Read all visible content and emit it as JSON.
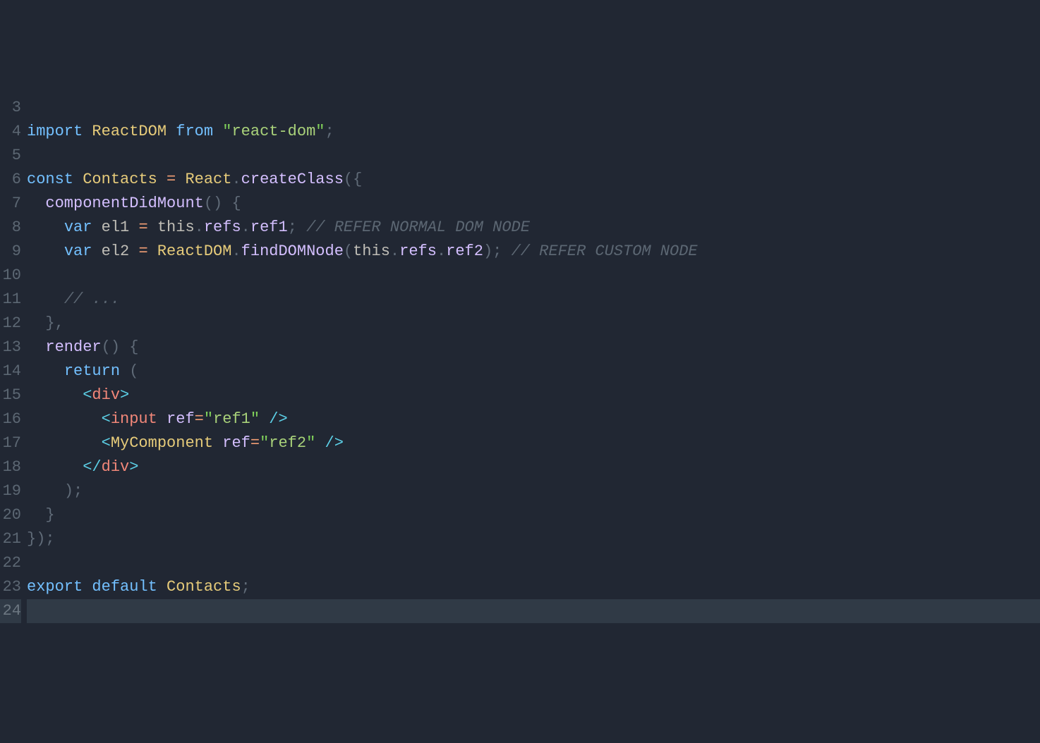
{
  "lines": [
    {
      "num": "3",
      "current": false,
      "tokens": []
    },
    {
      "num": "4",
      "current": false,
      "tokens": [
        {
          "cls": "kw",
          "t": "import"
        },
        {
          "cls": "",
          "t": " "
        },
        {
          "cls": "class",
          "t": "ReactDOM"
        },
        {
          "cls": "",
          "t": " "
        },
        {
          "cls": "kw",
          "t": "from"
        },
        {
          "cls": "",
          "t": " "
        },
        {
          "cls": "strq",
          "t": "\""
        },
        {
          "cls": "str",
          "t": "react-dom"
        },
        {
          "cls": "strq",
          "t": "\""
        },
        {
          "cls": "punct",
          "t": ";"
        }
      ]
    },
    {
      "num": "5",
      "current": false,
      "tokens": []
    },
    {
      "num": "6",
      "current": false,
      "tokens": [
        {
          "cls": "kw",
          "t": "const"
        },
        {
          "cls": "",
          "t": " "
        },
        {
          "cls": "class",
          "t": "Contacts"
        },
        {
          "cls": "",
          "t": " "
        },
        {
          "cls": "op",
          "t": "="
        },
        {
          "cls": "",
          "t": " "
        },
        {
          "cls": "class",
          "t": "React"
        },
        {
          "cls": "punct",
          "t": "."
        },
        {
          "cls": "method",
          "t": "createClass"
        },
        {
          "cls": "punct",
          "t": "({"
        }
      ]
    },
    {
      "num": "7",
      "current": false,
      "tokens": [
        {
          "cls": "",
          "t": "  "
        },
        {
          "cls": "method",
          "t": "componentDidMount"
        },
        {
          "cls": "punct",
          "t": "()"
        },
        {
          "cls": "",
          "t": " "
        },
        {
          "cls": "punct",
          "t": "{"
        }
      ]
    },
    {
      "num": "8",
      "current": false,
      "tokens": [
        {
          "cls": "",
          "t": "    "
        },
        {
          "cls": "kw",
          "t": "var"
        },
        {
          "cls": "",
          "t": " "
        },
        {
          "cls": "localv",
          "t": "el1"
        },
        {
          "cls": "",
          "t": " "
        },
        {
          "cls": "op",
          "t": "="
        },
        {
          "cls": "",
          "t": " "
        },
        {
          "cls": "localv",
          "t": "this"
        },
        {
          "cls": "punct",
          "t": "."
        },
        {
          "cls": "prop",
          "t": "refs"
        },
        {
          "cls": "punct",
          "t": "."
        },
        {
          "cls": "prop",
          "t": "ref1"
        },
        {
          "cls": "punct",
          "t": ";"
        },
        {
          "cls": "",
          "t": " "
        },
        {
          "cls": "comment",
          "t": "// REFER NORMAL DOM NODE"
        }
      ]
    },
    {
      "num": "9",
      "current": false,
      "tokens": [
        {
          "cls": "",
          "t": "    "
        },
        {
          "cls": "kw",
          "t": "var"
        },
        {
          "cls": "",
          "t": " "
        },
        {
          "cls": "localv",
          "t": "el2"
        },
        {
          "cls": "",
          "t": " "
        },
        {
          "cls": "op",
          "t": "="
        },
        {
          "cls": "",
          "t": " "
        },
        {
          "cls": "class",
          "t": "ReactDOM"
        },
        {
          "cls": "punct",
          "t": "."
        },
        {
          "cls": "method",
          "t": "findDOMNode"
        },
        {
          "cls": "punct",
          "t": "("
        },
        {
          "cls": "localv",
          "t": "this"
        },
        {
          "cls": "punct",
          "t": "."
        },
        {
          "cls": "prop",
          "t": "refs"
        },
        {
          "cls": "punct",
          "t": "."
        },
        {
          "cls": "prop",
          "t": "ref2"
        },
        {
          "cls": "punct",
          "t": ");"
        },
        {
          "cls": "",
          "t": " "
        },
        {
          "cls": "comment",
          "t": "// REFER CUSTOM NODE"
        }
      ]
    },
    {
      "num": "10",
      "current": false,
      "tokens": []
    },
    {
      "num": "11",
      "current": false,
      "tokens": [
        {
          "cls": "",
          "t": "    "
        },
        {
          "cls": "comment",
          "t": "// ..."
        }
      ]
    },
    {
      "num": "12",
      "current": false,
      "tokens": [
        {
          "cls": "",
          "t": "  "
        },
        {
          "cls": "punct",
          "t": "},"
        }
      ]
    },
    {
      "num": "13",
      "current": false,
      "tokens": [
        {
          "cls": "",
          "t": "  "
        },
        {
          "cls": "method",
          "t": "render"
        },
        {
          "cls": "punct",
          "t": "()"
        },
        {
          "cls": "",
          "t": " "
        },
        {
          "cls": "punct",
          "t": "{"
        }
      ]
    },
    {
      "num": "14",
      "current": false,
      "tokens": [
        {
          "cls": "",
          "t": "    "
        },
        {
          "cls": "kw",
          "t": "return"
        },
        {
          "cls": "",
          "t": " "
        },
        {
          "cls": "punct",
          "t": "("
        }
      ]
    },
    {
      "num": "15",
      "current": false,
      "tokens": [
        {
          "cls": "",
          "t": "      "
        },
        {
          "cls": "tagb",
          "t": "<"
        },
        {
          "cls": "tag",
          "t": "div"
        },
        {
          "cls": "tagb",
          "t": ">"
        }
      ]
    },
    {
      "num": "16",
      "current": false,
      "tokens": [
        {
          "cls": "",
          "t": "        "
        },
        {
          "cls": "tagb",
          "t": "<"
        },
        {
          "cls": "tag",
          "t": "input"
        },
        {
          "cls": "",
          "t": " "
        },
        {
          "cls": "attr",
          "t": "ref"
        },
        {
          "cls": "op",
          "t": "="
        },
        {
          "cls": "strq",
          "t": "\""
        },
        {
          "cls": "str",
          "t": "ref1"
        },
        {
          "cls": "strq",
          "t": "\""
        },
        {
          "cls": "",
          "t": " "
        },
        {
          "cls": "tagb",
          "t": "/>"
        }
      ]
    },
    {
      "num": "17",
      "current": false,
      "tokens": [
        {
          "cls": "",
          "t": "        "
        },
        {
          "cls": "tagb",
          "t": "<"
        },
        {
          "cls": "class",
          "t": "MyComponent"
        },
        {
          "cls": "",
          "t": " "
        },
        {
          "cls": "attr",
          "t": "ref"
        },
        {
          "cls": "op",
          "t": "="
        },
        {
          "cls": "strq",
          "t": "\""
        },
        {
          "cls": "str",
          "t": "ref2"
        },
        {
          "cls": "strq",
          "t": "\""
        },
        {
          "cls": "",
          "t": " "
        },
        {
          "cls": "tagb",
          "t": "/>"
        }
      ]
    },
    {
      "num": "18",
      "current": false,
      "tokens": [
        {
          "cls": "",
          "t": "      "
        },
        {
          "cls": "tagb",
          "t": "</"
        },
        {
          "cls": "tag",
          "t": "div"
        },
        {
          "cls": "tagb",
          "t": ">"
        }
      ]
    },
    {
      "num": "19",
      "current": false,
      "tokens": [
        {
          "cls": "",
          "t": "    "
        },
        {
          "cls": "punct",
          "t": ");"
        }
      ]
    },
    {
      "num": "20",
      "current": false,
      "tokens": [
        {
          "cls": "",
          "t": "  "
        },
        {
          "cls": "punct",
          "t": "}"
        }
      ]
    },
    {
      "num": "21",
      "current": false,
      "tokens": [
        {
          "cls": "punct",
          "t": "});"
        }
      ]
    },
    {
      "num": "22",
      "current": false,
      "tokens": []
    },
    {
      "num": "23",
      "current": false,
      "tokens": [
        {
          "cls": "kw",
          "t": "export"
        },
        {
          "cls": "",
          "t": " "
        },
        {
          "cls": "kw",
          "t": "default"
        },
        {
          "cls": "",
          "t": " "
        },
        {
          "cls": "class",
          "t": "Contacts"
        },
        {
          "cls": "punct",
          "t": ";"
        }
      ]
    },
    {
      "num": "24",
      "current": true,
      "tokens": []
    }
  ]
}
